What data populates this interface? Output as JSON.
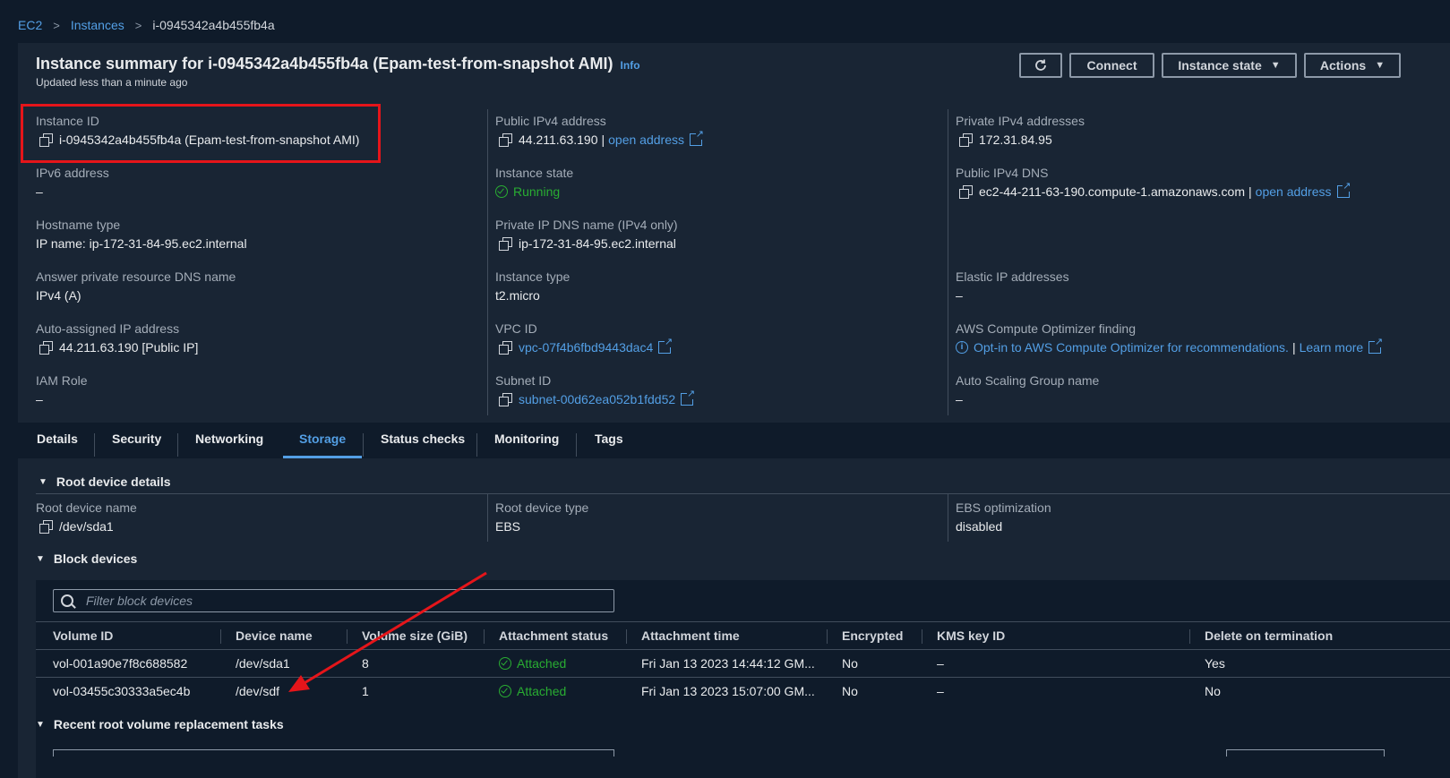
{
  "breadcrumb": {
    "root": "EC2",
    "section": "Instances",
    "current": "i-0945342a4b455fb4a"
  },
  "header": {
    "title": "Instance summary for i-0945342a4b455fb4a (Epam-test-from-snapshot AMI)",
    "info": "Info",
    "updated": "Updated less than a minute ago",
    "connect": "Connect",
    "instance_state": "Instance state",
    "actions": "Actions"
  },
  "summary": {
    "instance_id_label": "Instance ID",
    "instance_id": "i-0945342a4b455fb4a (Epam-test-from-snapshot AMI)",
    "ipv6_label": "IPv6 address",
    "ipv6": "–",
    "hostname_type_label": "Hostname type",
    "hostname_type": "IP name: ip-172-31-84-95.ec2.internal",
    "answer_dns_label": "Answer private resource DNS name",
    "answer_dns": "IPv4 (A)",
    "auto_ip_label": "Auto-assigned IP address",
    "auto_ip": "44.211.63.190 [Public IP]",
    "iam_label": "IAM Role",
    "iam": "–",
    "public_ipv4_label": "Public IPv4 address",
    "public_ipv4": "44.211.63.190",
    "sep": "|",
    "open_address": "open address",
    "state_label": "Instance state",
    "state": "Running",
    "private_dns_label": "Private IP DNS name (IPv4 only)",
    "private_dns": "ip-172-31-84-95.ec2.internal",
    "instance_type_label": "Instance type",
    "instance_type": "t2.micro",
    "vpc_label": "VPC ID",
    "vpc": "vpc-07f4b6fbd9443dac4",
    "subnet_label": "Subnet ID",
    "subnet": "subnet-00d62ea052b1fdd52",
    "private_ipv4_label": "Private IPv4 addresses",
    "private_ipv4": "172.31.84.95",
    "public_dns_label": "Public IPv4 DNS",
    "public_dns": "ec2-44-211-63-190.compute-1.amazonaws.com",
    "elastic_label": "Elastic IP addresses",
    "elastic": "–",
    "optimizer_label": "AWS Compute Optimizer finding",
    "optimizer": "Opt-in to AWS Compute Optimizer for recommendations.",
    "learn_more": "Learn more",
    "asg_label": "Auto Scaling Group name",
    "asg": "–"
  },
  "tabs": [
    "Details",
    "Security",
    "Networking",
    "Storage",
    "Status checks",
    "Monitoring",
    "Tags"
  ],
  "storage": {
    "root_section": "Root device details",
    "root_name_label": "Root device name",
    "root_name": "/dev/sda1",
    "root_type_label": "Root device type",
    "root_type": "EBS",
    "ebs_opt_label": "EBS optimization",
    "ebs_opt": "disabled",
    "block_section": "Block devices",
    "filter_placeholder": "Filter block devices",
    "columns": [
      "Volume ID",
      "Device name",
      "Volume size (GiB)",
      "Attachment status",
      "Attachment time",
      "Encrypted",
      "KMS key ID",
      "Delete on termination"
    ],
    "rows": [
      [
        "vol-001a90e7f8c688582",
        "/dev/sda1",
        "8",
        "Attached",
        "Fri Jan 13 2023 14:44:12 GM...",
        "No",
        "–",
        "Yes"
      ],
      [
        "vol-03455c30333a5ec4b",
        "/dev/sdf",
        "1",
        "Attached",
        "Fri Jan 13 2023 15:07:00 GM...",
        "No",
        "–",
        "No"
      ]
    ],
    "replacement_section": "Recent root volume replacement tasks"
  },
  "colors": {
    "accent": "#539fe5",
    "success": "#29ad32",
    "highlight": "#e5151a"
  }
}
